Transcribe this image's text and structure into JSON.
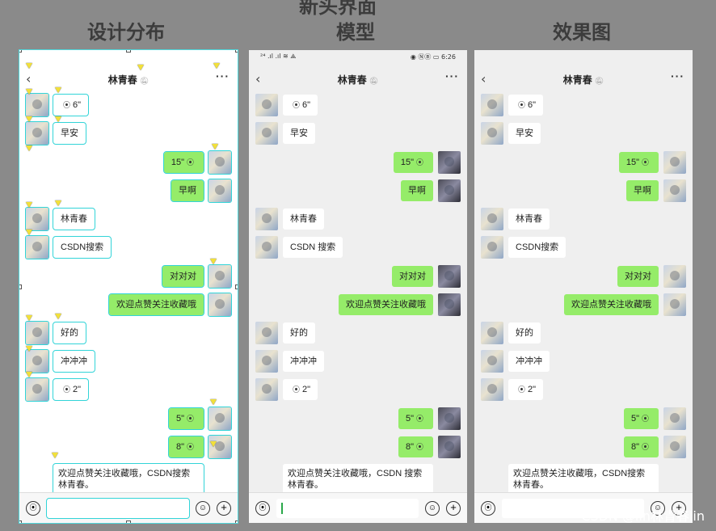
{
  "page": {
    "top_title": "新头界面",
    "columns": [
      "设计分布",
      "模型",
      "效果图"
    ],
    "watermark": "CSDN @lin林青春lin"
  },
  "status_bar": {
    "left": "²⁴ .ıl .ıl ≋ ⟁",
    "right": "◉ ⓃⒷ ▭ 6:26"
  },
  "chat": {
    "title": "林青春",
    "mute_icon": "bell-off-icon",
    "back_icon": "chevron-left-icon",
    "more_label": "···",
    "messages": [
      {
        "side": "left",
        "voice": true,
        "text": "6\""
      },
      {
        "side": "left",
        "text": "早安"
      },
      {
        "side": "right",
        "voice": true,
        "text": "15\""
      },
      {
        "side": "right",
        "text": "早啊"
      },
      {
        "side": "left",
        "text": "林青春"
      },
      {
        "side": "left",
        "text": "CSDN搜索"
      },
      {
        "side": "right",
        "text": "对对对"
      },
      {
        "side": "right",
        "text": "欢迎点赞关注收藏哦"
      },
      {
        "side": "left",
        "text": "好的"
      },
      {
        "side": "left",
        "text": "冲冲冲"
      },
      {
        "side": "left",
        "voice": true,
        "text": "2\""
      },
      {
        "side": "right",
        "voice": true,
        "text": "5\""
      },
      {
        "side": "right",
        "voice": true,
        "text": "8\""
      }
    ],
    "model_csdn": "CSDN 搜索",
    "long_message": "欢迎点赞关注收藏哦，CSDN搜索林青春。",
    "model_long_message": "欢迎点赞关注收藏哦，CSDN 搜索林青春。"
  },
  "input_bar": {
    "voice_icon": "voice-icon",
    "emoji_icon": "emoji-icon",
    "plus_icon": "plus-icon"
  },
  "colors": {
    "self_bubble": "#95ec69",
    "other_bubble": "#ffffff",
    "layout_outline": "#32d4d8"
  }
}
